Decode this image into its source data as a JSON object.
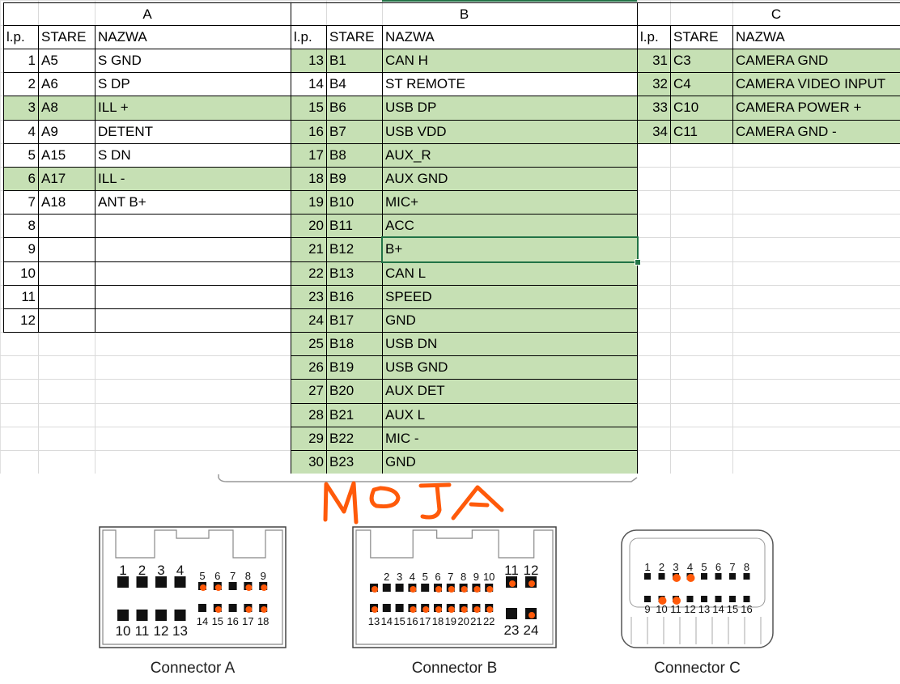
{
  "sheet": {
    "selected_cell": "B.12.nazwa",
    "highlight_color": "#c6e0b4",
    "selection_color": "#217346",
    "groups": [
      {
        "title": "A",
        "headers": [
          "l.p.",
          "STARE",
          "NAZWA"
        ],
        "rows": [
          {
            "lp": "1",
            "stare": "A5",
            "nazwa": "S GND",
            "highlight": false
          },
          {
            "lp": "2",
            "stare": "A6",
            "nazwa": "S DP",
            "highlight": false
          },
          {
            "lp": "3",
            "stare": "A8",
            "nazwa": "ILL +",
            "highlight": true
          },
          {
            "lp": "4",
            "stare": "A9",
            "nazwa": "DETENT",
            "highlight": false
          },
          {
            "lp": "5",
            "stare": "A15",
            "nazwa": "S DN",
            "highlight": false
          },
          {
            "lp": "6",
            "stare": "A17",
            "nazwa": "ILL -",
            "highlight": true
          },
          {
            "lp": "7",
            "stare": "A18",
            "nazwa": "ANT B+",
            "highlight": false
          },
          {
            "lp": "8",
            "stare": "",
            "nazwa": "",
            "highlight": false
          },
          {
            "lp": "9",
            "stare": "",
            "nazwa": "",
            "highlight": false
          },
          {
            "lp": "10",
            "stare": "",
            "nazwa": "",
            "highlight": false
          },
          {
            "lp": "11",
            "stare": "",
            "nazwa": "",
            "highlight": false
          },
          {
            "lp": "12",
            "stare": "",
            "nazwa": "",
            "highlight": false
          }
        ]
      },
      {
        "title": "B",
        "headers": [
          "l.p.",
          "STARE",
          "NAZWA"
        ],
        "rows": [
          {
            "lp": "13",
            "stare": "B1",
            "nazwa": "CAN H",
            "highlight": true
          },
          {
            "lp": "14",
            "stare": "B4",
            "nazwa": "ST REMOTE",
            "highlight": false
          },
          {
            "lp": "15",
            "stare": "B6",
            "nazwa": "USB DP",
            "highlight": true
          },
          {
            "lp": "16",
            "stare": "B7",
            "nazwa": "USB VDD",
            "highlight": true
          },
          {
            "lp": "17",
            "stare": "B8",
            "nazwa": "AUX_R",
            "highlight": true
          },
          {
            "lp": "18",
            "stare": "B9",
            "nazwa": "AUX GND",
            "highlight": true
          },
          {
            "lp": "19",
            "stare": "B10",
            "nazwa": "MIC+",
            "highlight": true
          },
          {
            "lp": "20",
            "stare": "B11",
            "nazwa": "ACC",
            "highlight": true
          },
          {
            "lp": "21",
            "stare": "B12",
            "nazwa": "B+",
            "highlight": true
          },
          {
            "lp": "22",
            "stare": "B13",
            "nazwa": "CAN L",
            "highlight": true
          },
          {
            "lp": "23",
            "stare": "B16",
            "nazwa": "SPEED",
            "highlight": true
          },
          {
            "lp": "24",
            "stare": "B17",
            "nazwa": "GND",
            "highlight": true
          },
          {
            "lp": "25",
            "stare": "B18",
            "nazwa": "USB DN",
            "highlight": true
          },
          {
            "lp": "26",
            "stare": "B19",
            "nazwa": "USB GND",
            "highlight": true
          },
          {
            "lp": "27",
            "stare": "B20",
            "nazwa": "AUX DET",
            "highlight": true
          },
          {
            "lp": "28",
            "stare": "B21",
            "nazwa": "AUX L",
            "highlight": true
          },
          {
            "lp": "29",
            "stare": "B22",
            "nazwa": "MIC -",
            "highlight": true
          },
          {
            "lp": "30",
            "stare": "B23",
            "nazwa": "GND",
            "highlight": true
          }
        ]
      },
      {
        "title": "C",
        "headers": [
          "l.p.",
          "STARE",
          "NAZWA"
        ],
        "rows": [
          {
            "lp": "31",
            "stare": "C3",
            "nazwa": "CAMERA GND",
            "highlight": true
          },
          {
            "lp": "32",
            "stare": "C4",
            "nazwa": "CAMERA VIDEO INPUT",
            "highlight": true
          },
          {
            "lp": "33",
            "stare": "C10",
            "nazwa": "CAMERA POWER +",
            "highlight": true
          },
          {
            "lp": "34",
            "stare": "C11",
            "nazwa": "CAMERA GND -",
            "highlight": true
          }
        ]
      }
    ]
  },
  "picture": {
    "handwritten_note": "MOJA",
    "note_color": "#ff5a0a",
    "connectors": [
      {
        "caption": "Connector A",
        "marked_pins": [
          5,
          6,
          8,
          9,
          15,
          17,
          18
        ]
      },
      {
        "caption": "Connector B",
        "marked_pins": [
          1,
          4,
          6,
          7,
          8,
          9,
          10,
          11,
          12,
          13,
          16,
          17,
          18,
          19,
          20,
          21,
          22,
          24
        ]
      },
      {
        "caption": "Connector C",
        "marked_pins": [
          3,
          4,
          10,
          11
        ]
      }
    ]
  }
}
